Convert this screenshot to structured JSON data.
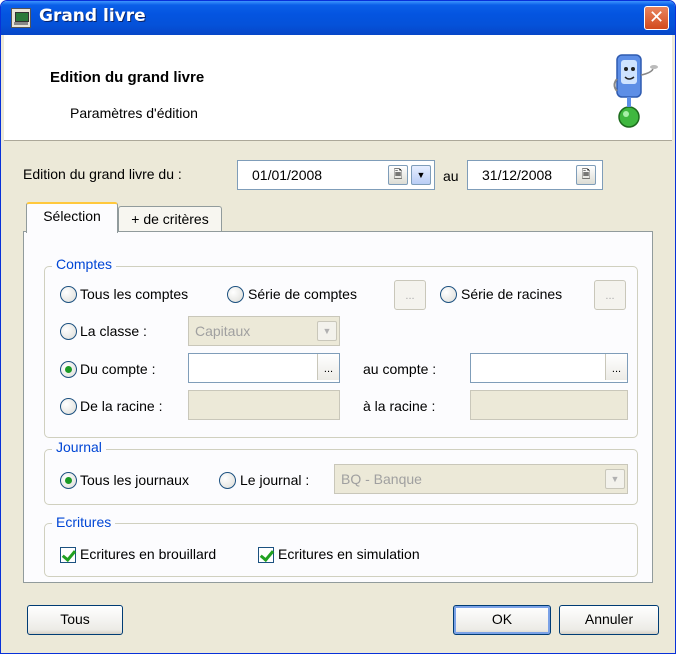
{
  "window": {
    "title": "Grand livre"
  },
  "header": {
    "title": "Edition du grand livre",
    "subtitle": "Paramètres d'édition"
  },
  "date_range": {
    "label_from": "Edition du grand livre du :",
    "from_value": "01/01/2008",
    "label_to": "au",
    "to_value": "31/12/2008"
  },
  "tabs": [
    {
      "label": "Sélection",
      "active": true
    },
    {
      "label": "+ de critères",
      "active": false
    }
  ],
  "comptes": {
    "group_title": "Comptes",
    "tous_comptes": "Tous les comptes",
    "serie_comptes": "Série de comptes",
    "serie_racines": "Série de racines",
    "la_classe": "La classe :",
    "classe_value": "Capitaux",
    "du_compte": "Du compte :",
    "du_compte_value": "",
    "au_compte": "au compte :",
    "au_compte_value": "",
    "de_la_racine": "De la racine :",
    "de_la_racine_value": "",
    "a_la_racine": "à la racine :",
    "a_la_racine_value": "",
    "selected": "du_compte",
    "ellipsis": "..."
  },
  "journal": {
    "group_title": "Journal",
    "tous_journaux": "Tous les journaux",
    "le_journal": "Le journal :",
    "journal_value": "BQ - Banque",
    "selected": "tous_journaux"
  },
  "ecritures": {
    "group_title": "Ecritures",
    "brouillard": "Ecritures en brouillard",
    "brouillard_checked": true,
    "simulation": "Ecritures en simulation",
    "simulation_checked": true
  },
  "buttons": {
    "tous": "Tous",
    "ok": "OK",
    "annuler": "Annuler"
  }
}
